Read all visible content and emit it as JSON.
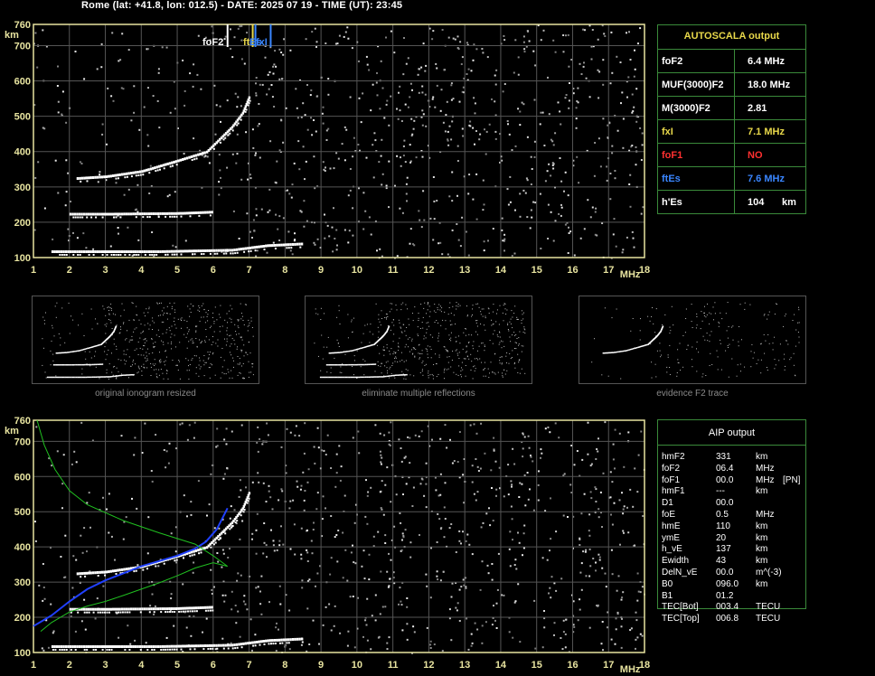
{
  "header": "Rome (lat: +41.8, lon: 012.5) - DATE: 2025 07 19 - TIME (UT): 23:45",
  "axes": {
    "y_unit": "km",
    "x_unit": "MHz",
    "y_ticks": [
      100,
      200,
      300,
      400,
      500,
      600,
      700,
      760
    ],
    "x_ticks": [
      1,
      2,
      3,
      4,
      5,
      6,
      7,
      8,
      9,
      10,
      11,
      12,
      13,
      14,
      15,
      16,
      17,
      18
    ],
    "xlim": [
      1,
      18
    ],
    "ylim": [
      100,
      760
    ]
  },
  "markers": [
    {
      "label": "foF2",
      "freq": 6.4,
      "color": "#ffffff"
    },
    {
      "label": "ft",
      "freq": 7.1,
      "color": "#e8d84a"
    },
    {
      "label": "Es",
      "freq": 7.1,
      "color": "#3a86ff"
    },
    {
      "label": "fxI",
      "freq": 7.6,
      "color": "#3a86ff"
    }
  ],
  "autoscala": {
    "title": "AUTOSCALA output",
    "rows": [
      {
        "label": "foF2",
        "value": "6.4 MHz",
        "color": "#ffffff"
      },
      {
        "label": "MUF(3000)F2",
        "value": "18.0 MHz",
        "color": "#ffffff"
      },
      {
        "label": "M(3000)F2",
        "value": "2.81",
        "color": "#ffffff"
      },
      {
        "label": "fxI",
        "value": "7.1 MHz",
        "color": "#e8d84a"
      },
      {
        "label": "foF1",
        "value": "NO",
        "color": "#ff3030"
      },
      {
        "label": "ftEs",
        "value": "7.6 MHz",
        "color": "#3a86ff"
      },
      {
        "label": "h'Es",
        "value": "104",
        "unit": "km",
        "color": "#ffffff"
      }
    ]
  },
  "thumbnails": [
    {
      "caption": "original ionogram resized"
    },
    {
      "caption": "eliminate multiple reflections"
    },
    {
      "caption": "evidence F2 trace"
    }
  ],
  "aip": {
    "title": "AIP output",
    "rows": [
      {
        "name": "hmF2",
        "value": "331",
        "unit": "km",
        "extra": ""
      },
      {
        "name": "foF2",
        "value": "06.4",
        "unit": "MHz",
        "extra": ""
      },
      {
        "name": "foF1",
        "value": "00.0",
        "unit": "MHz",
        "extra": "[PN]"
      },
      {
        "name": "hmF1",
        "value": "---",
        "unit": "km",
        "extra": ""
      },
      {
        "name": "D1",
        "value": "00.0",
        "unit": "",
        "extra": ""
      },
      {
        "name": "foE",
        "value": "0.5",
        "unit": "MHz",
        "extra": ""
      },
      {
        "name": "hmE",
        "value": "110",
        "unit": "km",
        "extra": ""
      },
      {
        "name": "ymE",
        "value": "20",
        "unit": "km",
        "extra": ""
      },
      {
        "name": "h_vE",
        "value": "137",
        "unit": "km",
        "extra": ""
      },
      {
        "name": "Ewidth",
        "value": "43",
        "unit": "km",
        "extra": ""
      },
      {
        "name": "DelN_vE",
        "value": "00.0",
        "unit": "m^(-3)",
        "extra": ""
      },
      {
        "name": "B0",
        "value": "096.0",
        "unit": "km",
        "extra": ""
      },
      {
        "name": "B1",
        "value": "01.2",
        "unit": "",
        "extra": ""
      },
      {
        "name": "TEC[Bot]",
        "value": "003.4",
        "unit": "TECU",
        "extra": ""
      },
      {
        "name": "TEC[Top]",
        "value": "006.8",
        "unit": "TECU",
        "extra": ""
      }
    ]
  },
  "chart_data": [
    {
      "type": "scatter",
      "title": "",
      "xlabel": "MHz",
      "ylabel": "km",
      "xlim": [
        1,
        18
      ],
      "ylim": [
        100,
        760
      ],
      "grid": true,
      "series": [
        {
          "name": "",
          "color": "#ffffff",
          "x": [
            1.5,
            2.5,
            3.5,
            4.5,
            5.5,
            6.5,
            7.5,
            8.5
          ],
          "y": [
            118,
            118,
            118,
            118,
            120,
            122,
            135,
            140
          ]
        },
        {
          "name": "",
          "color": "#ffffff",
          "x": [
            2.0,
            3.0,
            4.0,
            5.0,
            6.0
          ],
          "y": [
            224,
            224,
            225,
            226,
            230
          ]
        },
        {
          "name": "",
          "color": "#ffffff",
          "x": [
            2.2,
            3.0,
            4.0,
            5.0,
            5.8,
            6.2,
            6.5,
            6.8,
            7.0
          ],
          "y": [
            325,
            330,
            345,
            375,
            400,
            440,
            470,
            510,
            560
          ]
        }
      ]
    },
    {
      "type": "line",
      "title": "",
      "xlabel": "MHz",
      "ylabel": "km",
      "xlim": [
        1,
        18
      ],
      "ylim": [
        100,
        760
      ],
      "grid": true,
      "series": [
        {
          "name": "",
          "color": "#2040ff",
          "x": [
            1.0,
            1.5,
            2.0,
            2.5,
            3.0,
            3.5,
            4.0,
            4.5,
            5.0,
            5.5,
            5.8,
            6.1,
            6.4
          ],
          "y": [
            175,
            205,
            245,
            280,
            305,
            325,
            345,
            360,
            375,
            395,
            415,
            450,
            510
          ]
        },
        {
          "name": "",
          "color": "#20c020",
          "x": [
            1.2,
            1.5,
            2.0,
            2.5,
            3.0,
            3.5,
            4.0,
            4.5,
            5.0,
            5.5,
            6.0,
            6.4,
            6.0,
            5.5,
            4.5,
            3.5,
            2.5,
            2.0,
            1.6,
            1.3,
            1.1
          ],
          "y": [
            160,
            185,
            215,
            232,
            245,
            262,
            280,
            298,
            318,
            340,
            355,
            345,
            375,
            408,
            440,
            475,
            520,
            560,
            620,
            690,
            760
          ]
        }
      ]
    }
  ]
}
